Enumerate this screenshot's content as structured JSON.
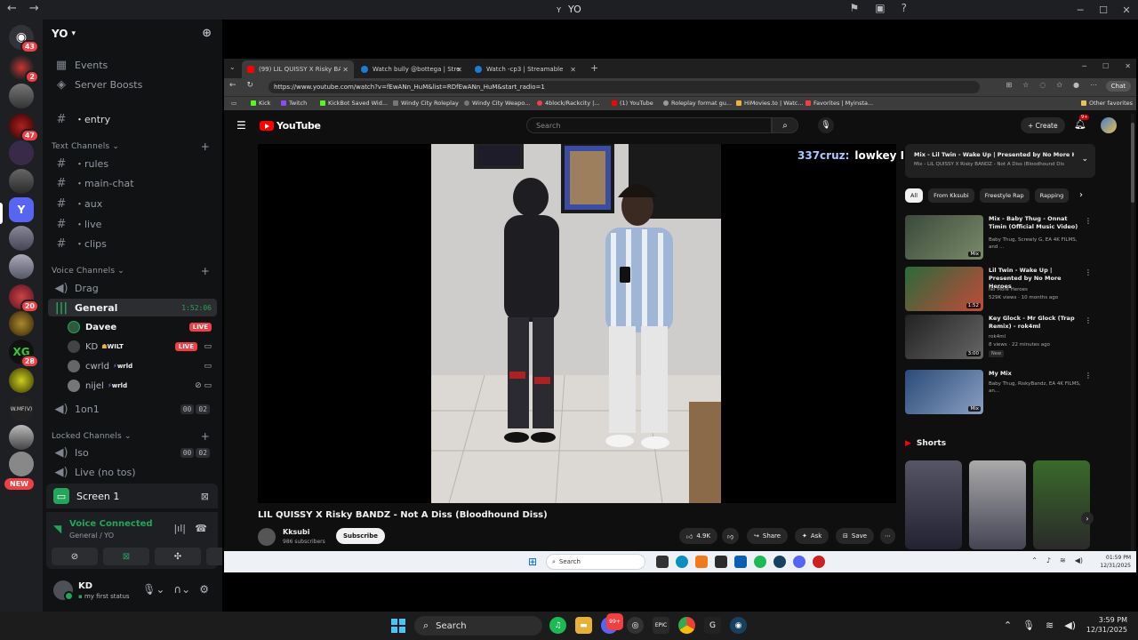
{
  "window": {
    "title": "YO",
    "back_icon": "arrow-left",
    "forward_icon": "arrow-right"
  },
  "server_rail": {
    "badges": [
      "43",
      "2",
      "47",
      "20",
      "28"
    ],
    "new_label": "NEW"
  },
  "guild": {
    "name": "YO"
  },
  "sidebar": {
    "events": "Events",
    "boosts": "Server Boosts",
    "entry": "・entry",
    "text_category": "Text Channels",
    "text_channels": [
      "・rules",
      "・main-chat",
      "・aux",
      "・live",
      "・clips"
    ],
    "voice_category": "Voice Channels",
    "drag": "Drag",
    "general": "General",
    "general_timer": "1:52:06",
    "voice_users": [
      {
        "name": "Davee",
        "tag": "",
        "live": "LIVE"
      },
      {
        "name": "KD",
        "tag": "WILT",
        "live": "LIVE"
      },
      {
        "name": "cwrld",
        "tag": "wrld",
        "live": ""
      },
      {
        "name": "nijel",
        "tag": "wrld",
        "live": ""
      }
    ],
    "one_on_one": "1on1",
    "one_on_one_counts": [
      "00",
      "02"
    ],
    "locked_category": "Locked Channels",
    "iso": "Iso",
    "iso_counts": [
      "00",
      "02"
    ],
    "live_no_tos": "Live (no tos)"
  },
  "screen_panel": {
    "label": "Screen 1"
  },
  "voice_panel": {
    "status": "Voice Connected",
    "location": "General / YO"
  },
  "user_panel": {
    "name": "KD",
    "status": "my first status"
  },
  "browser": {
    "tabs": [
      "(99) LIL QUISSY X Risky BANDZ",
      "Watch bully @bottega | Streamable",
      "Watch -cp3 | Streamable"
    ],
    "url": "https://www.youtube.com/watch?v=fEwANn_HuM&list=RDfEwANn_HuM&start_radio=1",
    "chat_label": "Chat",
    "bookmarks": [
      "Kick",
      "Twitch",
      "KickBot Saved Wid...",
      "Windy City Roleplay",
      "Windy City Weapo...",
      "4block/Rackcity |...",
      "(1) YouTube",
      "Roleplay format gu...",
      "HiMovies.to | Watc...",
      "Favorites | Myinsta..."
    ],
    "other_favorites": "Other favorites"
  },
  "youtube": {
    "logo_text": "YouTube",
    "search_placeholder": "Search",
    "create_label": "Create",
    "bell_count": "9+",
    "overlay_user": "337cruz:",
    "overlay_msg": "lowkey I'll kill Capp",
    "video_title": "LIL QUISSY X Risky BANDZ - Not A Diss (Bloodhound Diss)",
    "channel": "Kksubi",
    "subscribers": "986 subscribers",
    "subscribe_label": "Subscribe",
    "likes": "4.9K",
    "share_label": "Share",
    "ask_label": "Ask",
    "save_label": "Save",
    "mix_title": "Mix - Lil Twin - Wake Up | Presented by No More He...",
    "mix_sub": "Mix - LIL QUISSY X Risky BANDZ - Not A Diss (Bloodhound Dis",
    "chips": [
      "All",
      "From Kksubi",
      "Freestyle Rap",
      "Rapping"
    ],
    "recs": [
      {
        "title": "Mix - Baby Thug - Onnat Timin (Official Music Video)",
        "sub": "Baby Thug, Screwly G, EA 4K FILMS, and ...",
        "sub2": "",
        "dur": "Mix",
        "new": ""
      },
      {
        "title": "Lil Twin - Wake Up | Presented by No More Heroes",
        "sub": "No More Heroes",
        "sub2": "529K views · 10 months ago",
        "dur": "1:52",
        "new": ""
      },
      {
        "title": "Key Glock - Mr Glock (Trap Remix) - rok4ml",
        "sub": "rok4ml",
        "sub2": "8 views · 22 minutes ago",
        "dur": "3:00",
        "new": "New"
      },
      {
        "title": "My Mix",
        "sub": "Baby Thug, RiskyBandz, EA 4K FILMS, an...",
        "sub2": "",
        "dur": "Mix",
        "new": ""
      }
    ],
    "shorts_label": "Shorts"
  },
  "inner_taskbar": {
    "search": "Search",
    "time": "01:59 PM",
    "date": "12/31/2025"
  },
  "taskbar": {
    "search": "Search",
    "time": "3:59 PM",
    "date": "12/31/2025",
    "discord_badge": "99+"
  }
}
